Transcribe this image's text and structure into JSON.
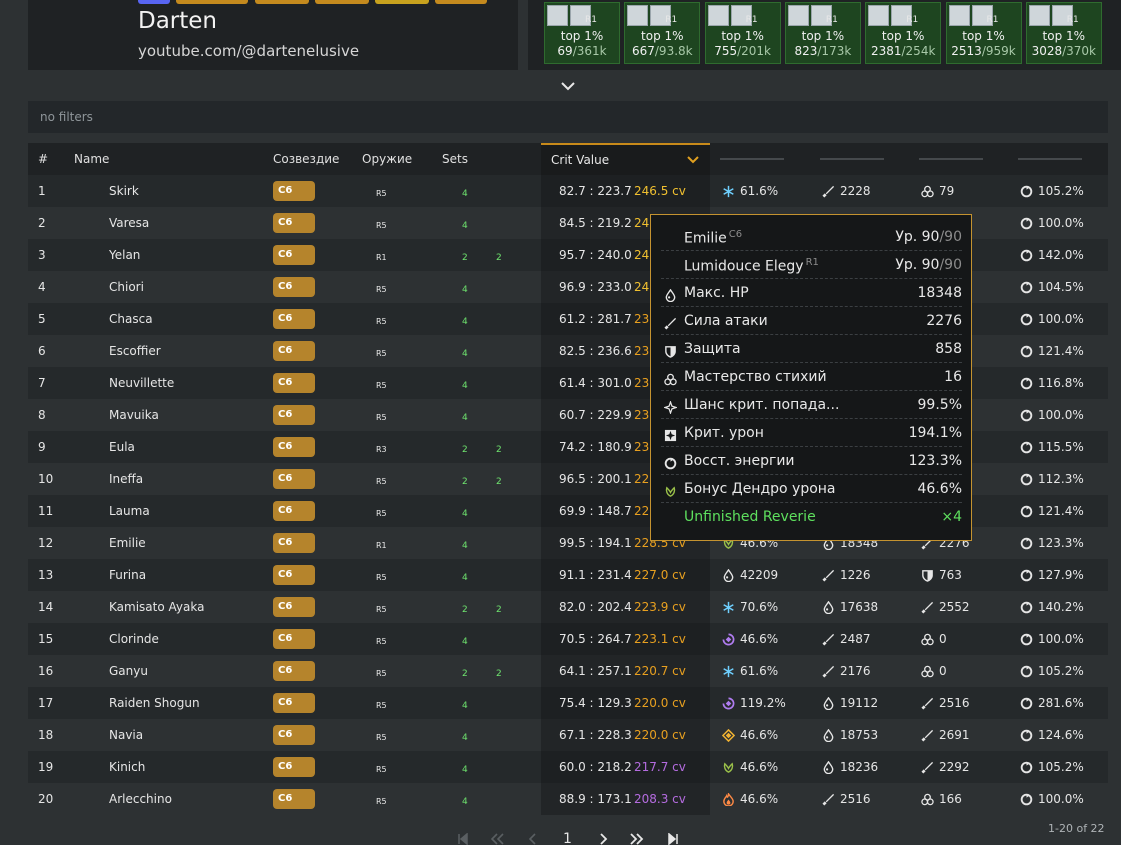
{
  "profile": {
    "name": "Darten",
    "link": "youtube.com/@dartenelusive",
    "badge_colors": [
      "#5865f2",
      "#c48a1e",
      "#c48a1e",
      "#c48a1e",
      "#c8a21e",
      "#c48a1e"
    ]
  },
  "achievements": [
    {
      "top": "top 1%",
      "rank": "69",
      "total": "361k",
      "r": "R1"
    },
    {
      "top": "top 1%",
      "rank": "667",
      "total": "93.8k",
      "r": "R1"
    },
    {
      "top": "top 1%",
      "rank": "755",
      "total": "201k",
      "r": "R1"
    },
    {
      "top": "top 1%",
      "rank": "823",
      "total": "173k",
      "r": "R1"
    },
    {
      "top": "top 1%",
      "rank": "2381",
      "total": "254k",
      "r": "R1"
    },
    {
      "top": "top 1%",
      "rank": "2513",
      "total": "959k",
      "r": "R1"
    },
    {
      "top": "top 1%",
      "rank": "3028",
      "total": "370k",
      "r": "R1"
    }
  ],
  "filter": {
    "text": "no filters"
  },
  "table": {
    "headers": {
      "rank": "#",
      "name": "Name",
      "const": "Созвездие",
      "weapon": "Оружие",
      "sets": "Sets",
      "crit": "Crit Value"
    },
    "rows": [
      {
        "rank": "1",
        "name": "Skirk",
        "const": "C6",
        "ref": "R5",
        "set1": "4",
        "set2": "",
        "ratio": "82.7 : 223.7",
        "cv": "246.5 cv",
        "cvColor": "#f0c030",
        "stats": [
          {
            "icon": "cryo",
            "v": "61.6%"
          },
          {
            "icon": "atk",
            "v": "2228"
          },
          {
            "icon": "em",
            "v": "79"
          },
          {
            "icon": "er",
            "v": "105.2%"
          }
        ]
      },
      {
        "rank": "2",
        "name": "Varesa",
        "const": "C6",
        "ref": "R5",
        "set1": "4",
        "set2": "",
        "ratio": "84.5 : 219.2",
        "cv": "24",
        "cvColor": "#f0c030",
        "stats": [
          {
            "icon": "",
            "v": ""
          },
          {
            "icon": "",
            "v": ""
          },
          {
            "icon": "",
            "v": ""
          },
          {
            "icon": "er",
            "v": "100.0%"
          }
        ]
      },
      {
        "rank": "3",
        "name": "Yelan",
        "const": "C6",
        "ref": "R1",
        "set1": "2",
        "set2": "2",
        "ratio": "95.7 : 240.0",
        "cv": "24",
        "cvColor": "#f0c030",
        "stats": [
          {
            "icon": "",
            "v": ""
          },
          {
            "icon": "",
            "v": ""
          },
          {
            "icon": "",
            "v": ""
          },
          {
            "icon": "er",
            "v": "142.0%"
          }
        ]
      },
      {
        "rank": "4",
        "name": "Chiori",
        "const": "C6",
        "ref": "R5",
        "set1": "4",
        "set2": "",
        "ratio": "96.9 : 233.0",
        "cv": "24",
        "cvColor": "#f0c030",
        "stats": [
          {
            "icon": "",
            "v": ""
          },
          {
            "icon": "",
            "v": ""
          },
          {
            "icon": "",
            "v": ""
          },
          {
            "icon": "er",
            "v": "104.5%"
          }
        ]
      },
      {
        "rank": "5",
        "name": "Chasca",
        "const": "C6",
        "ref": "R5",
        "set1": "4",
        "set2": "",
        "ratio": "61.2 : 281.7",
        "cv": "23",
        "cvColor": "#e8a020",
        "stats": [
          {
            "icon": "",
            "v": ""
          },
          {
            "icon": "",
            "v": ""
          },
          {
            "icon": "",
            "v": ""
          },
          {
            "icon": "er",
            "v": "100.0%"
          }
        ]
      },
      {
        "rank": "6",
        "name": "Escoffier",
        "const": "C6",
        "ref": "R5",
        "set1": "4",
        "set2": "",
        "ratio": "82.5 : 236.6",
        "cv": "23",
        "cvColor": "#e8a020",
        "stats": [
          {
            "icon": "",
            "v": ""
          },
          {
            "icon": "",
            "v": ""
          },
          {
            "icon": "",
            "v": ""
          },
          {
            "icon": "er",
            "v": "121.4%"
          }
        ]
      },
      {
        "rank": "7",
        "name": "Neuvillette",
        "const": "C6",
        "ref": "R5",
        "set1": "4",
        "set2": "",
        "ratio": "61.4 : 301.0",
        "cv": "23",
        "cvColor": "#e8a020",
        "stats": [
          {
            "icon": "",
            "v": ""
          },
          {
            "icon": "",
            "v": ""
          },
          {
            "icon": "",
            "v": ""
          },
          {
            "icon": "er",
            "v": "116.8%"
          }
        ]
      },
      {
        "rank": "8",
        "name": "Mavuika",
        "const": "C6",
        "ref": "R5",
        "set1": "4",
        "set2": "",
        "ratio": "60.7 : 229.9",
        "cv": "23",
        "cvColor": "#e8a020",
        "stats": [
          {
            "icon": "",
            "v": ""
          },
          {
            "icon": "",
            "v": ""
          },
          {
            "icon": "",
            "v": ""
          },
          {
            "icon": "er",
            "v": "100.0%"
          }
        ]
      },
      {
        "rank": "9",
        "name": "Eula",
        "const": "C6",
        "ref": "R3",
        "set1": "2",
        "set2": "2",
        "ratio": "74.2 : 180.9",
        "cv": "23",
        "cvColor": "#e8a020",
        "stats": [
          {
            "icon": "",
            "v": ""
          },
          {
            "icon": "",
            "v": ""
          },
          {
            "icon": "",
            "v": ""
          },
          {
            "icon": "er",
            "v": "115.5%"
          }
        ]
      },
      {
        "rank": "10",
        "name": "Ineffa",
        "const": "C6",
        "ref": "R5",
        "set1": "2",
        "set2": "2",
        "ratio": "96.5 : 200.1",
        "cv": "22",
        "cvColor": "#e8a020",
        "stats": [
          {
            "icon": "",
            "v": ""
          },
          {
            "icon": "",
            "v": ""
          },
          {
            "icon": "",
            "v": ""
          },
          {
            "icon": "er",
            "v": "112.3%"
          }
        ]
      },
      {
        "rank": "11",
        "name": "Lauma",
        "const": "C6",
        "ref": "R5",
        "set1": "4",
        "set2": "",
        "ratio": "69.9 : 148.7",
        "cv": "22",
        "cvColor": "#e8a020",
        "stats": [
          {
            "icon": "",
            "v": ""
          },
          {
            "icon": "",
            "v": ""
          },
          {
            "icon": "",
            "v": ""
          },
          {
            "icon": "er",
            "v": "121.4%"
          }
        ]
      },
      {
        "rank": "12",
        "name": "Emilie",
        "const": "C6",
        "ref": "R1",
        "set1": "4",
        "set2": "",
        "ratio": "99.5 : 194.1",
        "cv": "228.5 cv",
        "cvColor": "#e8a020",
        "stats": [
          {
            "icon": "dendro",
            "v": "46.6%"
          },
          {
            "icon": "hp",
            "v": "18348"
          },
          {
            "icon": "atk",
            "v": "2276"
          },
          {
            "icon": "er",
            "v": "123.3%"
          }
        ]
      },
      {
        "rank": "13",
        "name": "Furina",
        "const": "C6",
        "ref": "R5",
        "set1": "4",
        "set2": "",
        "ratio": "91.1 : 231.4",
        "cv": "227.0 cv",
        "cvColor": "#e8a020",
        "stats": [
          {
            "icon": "hp",
            "v": "42209"
          },
          {
            "icon": "atk",
            "v": "1226"
          },
          {
            "icon": "def",
            "v": "763"
          },
          {
            "icon": "er",
            "v": "127.9%"
          }
        ]
      },
      {
        "rank": "14",
        "name": "Kamisato Ayaka",
        "const": "C6",
        "ref": "R5",
        "set1": "2",
        "set2": "2",
        "ratio": "82.0 : 202.4",
        "cv": "223.9 cv",
        "cvColor": "#e8a020",
        "stats": [
          {
            "icon": "cryo",
            "v": "70.6%"
          },
          {
            "icon": "hp",
            "v": "17638"
          },
          {
            "icon": "atk",
            "v": "2552"
          },
          {
            "icon": "er",
            "v": "140.2%"
          }
        ]
      },
      {
        "rank": "15",
        "name": "Clorinde",
        "const": "C6",
        "ref": "R5",
        "set1": "4",
        "set2": "",
        "ratio": "70.5 : 264.7",
        "cv": "223.1 cv",
        "cvColor": "#e8a020",
        "stats": [
          {
            "icon": "electro",
            "v": "46.6%"
          },
          {
            "icon": "atk",
            "v": "2487"
          },
          {
            "icon": "em",
            "v": "0"
          },
          {
            "icon": "er",
            "v": "100.0%"
          }
        ]
      },
      {
        "rank": "16",
        "name": "Ganyu",
        "const": "C6",
        "ref": "R5",
        "set1": "2",
        "set2": "2",
        "ratio": "64.1 : 257.1",
        "cv": "220.7 cv",
        "cvColor": "#e8a020",
        "stats": [
          {
            "icon": "cryo",
            "v": "61.6%"
          },
          {
            "icon": "atk",
            "v": "2176"
          },
          {
            "icon": "em",
            "v": "0"
          },
          {
            "icon": "er",
            "v": "105.2%"
          }
        ]
      },
      {
        "rank": "17",
        "name": "Raiden Shogun",
        "const": "C6",
        "ref": "R5",
        "set1": "4",
        "set2": "",
        "ratio": "75.4 : 129.3",
        "cv": "220.0 cv",
        "cvColor": "#e8a020",
        "stats": [
          {
            "icon": "electro",
            "v": "119.2%"
          },
          {
            "icon": "hp",
            "v": "19112"
          },
          {
            "icon": "atk",
            "v": "2516"
          },
          {
            "icon": "er",
            "v": "281.6%"
          }
        ]
      },
      {
        "rank": "18",
        "name": "Navia",
        "const": "C6",
        "ref": "R5",
        "set1": "4",
        "set2": "",
        "ratio": "67.1 : 228.3",
        "cv": "220.0 cv",
        "cvColor": "#e8a020",
        "stats": [
          {
            "icon": "geo",
            "v": "46.6%"
          },
          {
            "icon": "hp",
            "v": "18753"
          },
          {
            "icon": "atk",
            "v": "2691"
          },
          {
            "icon": "er",
            "v": "124.6%"
          }
        ]
      },
      {
        "rank": "19",
        "name": "Kinich",
        "const": "C6",
        "ref": "R5",
        "set1": "4",
        "set2": "",
        "ratio": "60.0 : 218.2",
        "cv": "217.7 cv",
        "cvColor": "#b56ce0",
        "stats": [
          {
            "icon": "dendro",
            "v": "46.6%"
          },
          {
            "icon": "hp",
            "v": "18236"
          },
          {
            "icon": "atk",
            "v": "2292"
          },
          {
            "icon": "er",
            "v": "105.2%"
          }
        ]
      },
      {
        "rank": "20",
        "name": "Arlecchino",
        "const": "C6",
        "ref": "R5",
        "set1": "4",
        "set2": "",
        "ratio": "88.9 : 173.1",
        "cv": "208.3 cv",
        "cvColor": "#b56ce0",
        "stats": [
          {
            "icon": "pyro",
            "v": "46.6%"
          },
          {
            "icon": "atk",
            "v": "2516"
          },
          {
            "icon": "em",
            "v": "166"
          },
          {
            "icon": "er",
            "v": "100.0%"
          }
        ]
      }
    ]
  },
  "tooltip": {
    "rows": [
      {
        "icon": "",
        "label": "Emilie",
        "sup": "C6",
        "value": "Ур. 90",
        "value_dim": "/90"
      },
      {
        "icon": "",
        "label": "Lumidouce Elegy",
        "sup": "R1",
        "value": "Ур. 90",
        "value_dim": "/90"
      },
      {
        "icon": "hp",
        "label": "Макс. HP",
        "sup": "",
        "value": "18348",
        "value_dim": ""
      },
      {
        "icon": "atk",
        "label": "Сила атаки",
        "sup": "",
        "value": "2276",
        "value_dim": ""
      },
      {
        "icon": "def",
        "label": "Защита",
        "sup": "",
        "value": "858",
        "value_dim": ""
      },
      {
        "icon": "em",
        "label": "Мастерство стихий",
        "sup": "",
        "value": "16",
        "value_dim": ""
      },
      {
        "icon": "cr",
        "label": "Шанс крит. попада...",
        "sup": "",
        "value": "99.5%",
        "value_dim": ""
      },
      {
        "icon": "cd",
        "label": "Крит. урон",
        "sup": "",
        "value": "194.1%",
        "value_dim": ""
      },
      {
        "icon": "er",
        "label": "Восст. энергии",
        "sup": "",
        "value": "123.3%",
        "value_dim": ""
      },
      {
        "icon": "dendro",
        "label": "Бонус Дендро урона",
        "sup": "",
        "value": "46.6%",
        "value_dim": ""
      },
      {
        "icon": "",
        "label": "Unfinished Reverie",
        "sup": "",
        "value": "×4",
        "value_dim": "",
        "set": true
      }
    ]
  },
  "pagination": {
    "page": "1",
    "count": "1-20 of 22"
  }
}
